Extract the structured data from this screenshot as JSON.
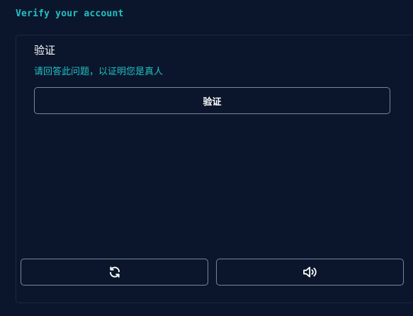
{
  "header": {
    "title": "Verify your account"
  },
  "panel": {
    "title": "验证",
    "subtitle": "请回答此问题，以证明您是真人",
    "verify_label": "验证"
  },
  "controls": {
    "refresh_icon": "refresh-icon",
    "audio_icon": "speaker-icon"
  },
  "colors": {
    "background": "#0b162c",
    "accent": "#22c1c3",
    "border": "#7c8597"
  }
}
